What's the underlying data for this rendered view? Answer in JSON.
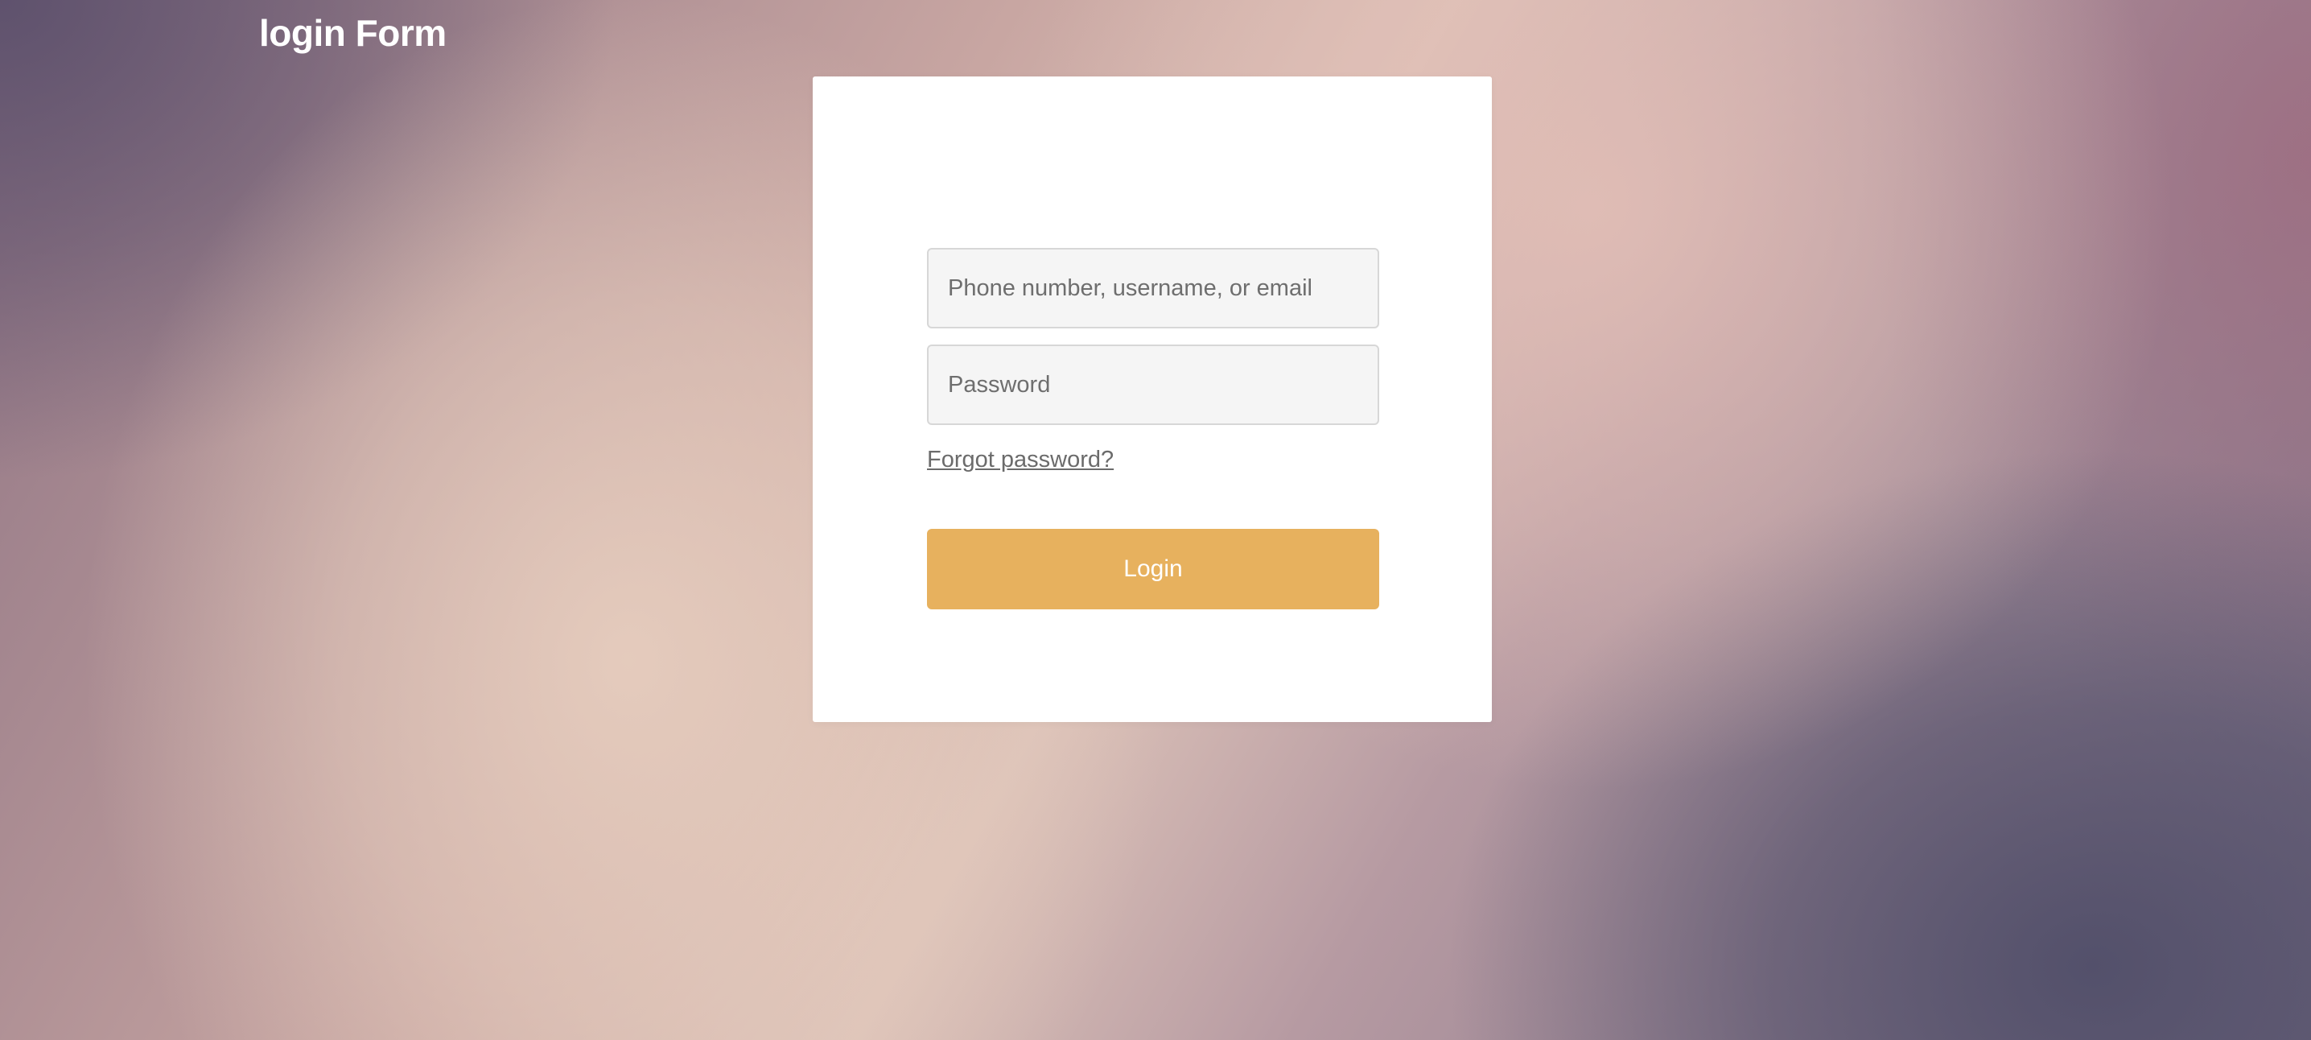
{
  "header": {
    "title": "login Form"
  },
  "form": {
    "username_placeholder": "Phone number, username, or email",
    "username_value": "",
    "password_placeholder": "Password",
    "password_value": "",
    "forgot_label": "Forgot password?",
    "login_label": "Login"
  },
  "colors": {
    "button": "#e7b15e",
    "card": "#ffffff",
    "field_background": "#f5f5f5"
  }
}
